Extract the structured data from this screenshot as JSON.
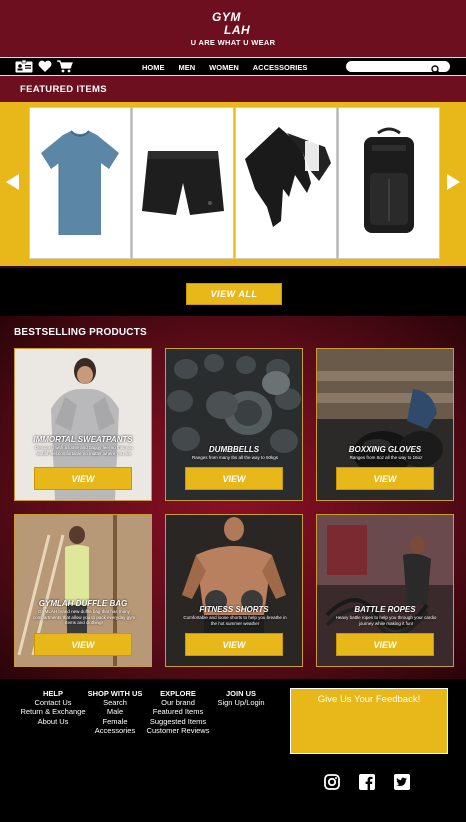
{
  "brand": {
    "line1": "GYM",
    "line2": "LAH",
    "tagline": "U ARE WHAT U WEAR"
  },
  "nav": {
    "links": [
      "HOME",
      "MEN",
      "WOMEN",
      "ACCESSORIES"
    ],
    "icons": [
      "id-card-icon",
      "heart-icon",
      "cart-icon"
    ],
    "search": {
      "value": "",
      "placeholder": ""
    }
  },
  "featured": {
    "title": "FEATURED ITEMS",
    "items": [
      "blue-tshirt",
      "black-shorts",
      "black-gloves",
      "black-backpack"
    ],
    "view_all": "VIEW ALL"
  },
  "bestselling": {
    "title": "BESTSELLING PRODUCTS",
    "products": [
      {
        "name": "IMMORTAL SWEATPANTS",
        "desc": "Designed with a loose and baggy feel so that you would feel comfortable no matter where you are",
        "button": "VIEW"
      },
      {
        "name": "DUMBBELLS",
        "desc": "Ranges from many Ibs all the way to 50kgs",
        "button": "VIEW"
      },
      {
        "name": "BOXXING GLOVES",
        "desc": "Ranges from 8oz all the way to 16oz",
        "button": "VIEW"
      },
      {
        "name": "GYMLAH DUFFLE BAG",
        "desc": "GYMLAH brand new duffle bag that has many compartments that allow you to pack everyday gym items and clothing!",
        "button": "VIEW"
      },
      {
        "name": "FITNESS SHORTS",
        "desc": "Comfortable and loose shorts to help you breathe in the hot summer weather",
        "button": "VIEW"
      },
      {
        "name": "BATTLE ROPES",
        "desc": "Heavy battle ropes to help you through your cardio journey while making it fun!",
        "button": "VIEW"
      }
    ]
  },
  "footer": {
    "help": {
      "title": "HELP",
      "items": [
        "Contact Us",
        "Return & Exchange",
        "About Us"
      ]
    },
    "shop": {
      "title": "SHOP WITH US",
      "items": [
        "Search",
        "Male",
        "Female",
        "Accessories"
      ]
    },
    "explore": {
      "title": "EXPLORE",
      "items": [
        "Our brand",
        "Featured Items",
        "Suggested Items",
        "Customer Reviews"
      ]
    },
    "join": {
      "title": "JOIN US",
      "items": [
        "Sign Up/Login"
      ]
    },
    "feedback": "Give Us Your Feedback!",
    "social": [
      "instagram-icon",
      "facebook-icon",
      "twitter-icon"
    ]
  },
  "colors": {
    "maroon": "#6d0f1e",
    "gold": "#e8b81a",
    "black": "#000000"
  }
}
